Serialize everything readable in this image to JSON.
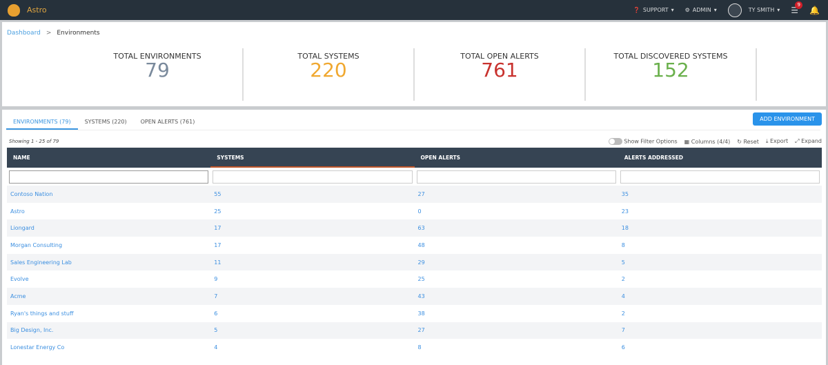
{
  "app": {
    "name": "Astro"
  },
  "nav": {
    "support": "SUPPORT",
    "admin": "ADMIN",
    "user": "TY SMITH",
    "notif_count": "9"
  },
  "breadcrumb": {
    "home": "Dashboard",
    "sep": ">",
    "current": "Environments"
  },
  "stats": [
    {
      "label": "TOTAL ENVIRONMENTS",
      "value": "79",
      "color": "#7a8a9c"
    },
    {
      "label": "TOTAL SYSTEMS",
      "value": "220",
      "color": "#f0a830"
    },
    {
      "label": "TOTAL OPEN ALERTS",
      "value": "761",
      "color": "#c8322e"
    },
    {
      "label": "TOTAL DISCOVERED SYSTEMS",
      "value": "152",
      "color": "#6ab04c"
    }
  ],
  "tabs": [
    "ENVIRONMENTS (79)",
    "SYSTEMS (220)",
    "OPEN ALERTS (761)"
  ],
  "add_button": "ADD ENVIRONMENT",
  "showing": "Showing 1 - 25 of 79",
  "tools": {
    "filter": "Show Filter Options",
    "columns": "Columns (4/4)",
    "reset": "Reset",
    "export": "Export",
    "expand": "Expand"
  },
  "columns": [
    "NAME",
    "SYSTEMS",
    "OPEN ALERTS",
    "ALERTS ADDRESSED"
  ],
  "rows": [
    [
      "Contoso Nation",
      "55",
      "27",
      "35"
    ],
    [
      "Astro",
      "25",
      "0",
      "23"
    ],
    [
      "Liongard",
      "17",
      "63",
      "18"
    ],
    [
      "Morgan Consulting",
      "17",
      "48",
      "8"
    ],
    [
      "Sales Engineering  Lab",
      "11",
      "29",
      "5"
    ],
    [
      "Evolve",
      "9",
      "25",
      "2"
    ],
    [
      "Acme",
      "7",
      "43",
      "4"
    ],
    [
      "Ryan's things and stuff",
      "6",
      "38",
      "2"
    ],
    [
      "Big Design, Inc.",
      "5",
      "27",
      "7"
    ],
    [
      "Lonestar Energy Co",
      "4",
      "8",
      "6"
    ]
  ]
}
